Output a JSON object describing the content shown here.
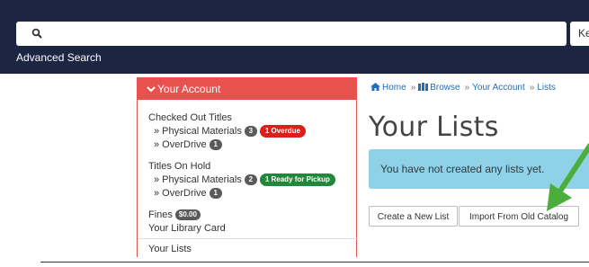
{
  "header": {
    "search_type_label": "Ke",
    "advanced_search_label": "Advanced Search"
  },
  "sidebar": {
    "heading": "Your Account",
    "checked_out": {
      "title": "Checked Out Titles",
      "physical_label": "» Physical Materials",
      "physical_count": "3",
      "overdue_label": "1 Overdue",
      "overdrive_label": "» OverDrive",
      "overdrive_count": "1"
    },
    "on_hold": {
      "title": "Titles On Hold",
      "physical_label": "» Physical Materials",
      "physical_count": "2",
      "ready_label": "1 Ready for Pickup",
      "overdrive_label": "» OverDrive",
      "overdrive_count": "1"
    },
    "fines_label": "Fines",
    "fines_amount": "$0.00",
    "library_card_label": "Your Library Card",
    "lists_label": "Your Lists"
  },
  "breadcrumb": {
    "home": "Home",
    "browse": "Browse",
    "account": "Your Account",
    "current": "Lists",
    "separator": "»"
  },
  "main": {
    "title": "Your Lists",
    "alert_text": "You have not created any lists yet.",
    "create_button": "Create a New List",
    "import_button": "Import From Old Catalog"
  },
  "colors": {
    "header_bg": "#1c2541",
    "sidebar_accent": "#e8524e",
    "alert_bg": "#8fd1e6",
    "overdue_badge": "#d9201a",
    "pickup_badge": "#22873b",
    "annotation_arrow": "#4cae3a",
    "link": "#1f6fb7"
  },
  "icons": {
    "search": "search-icon",
    "chevron": "chevron-down-icon",
    "home": "home-icon",
    "browse": "book-icon",
    "annotation": "arrow-icon"
  }
}
